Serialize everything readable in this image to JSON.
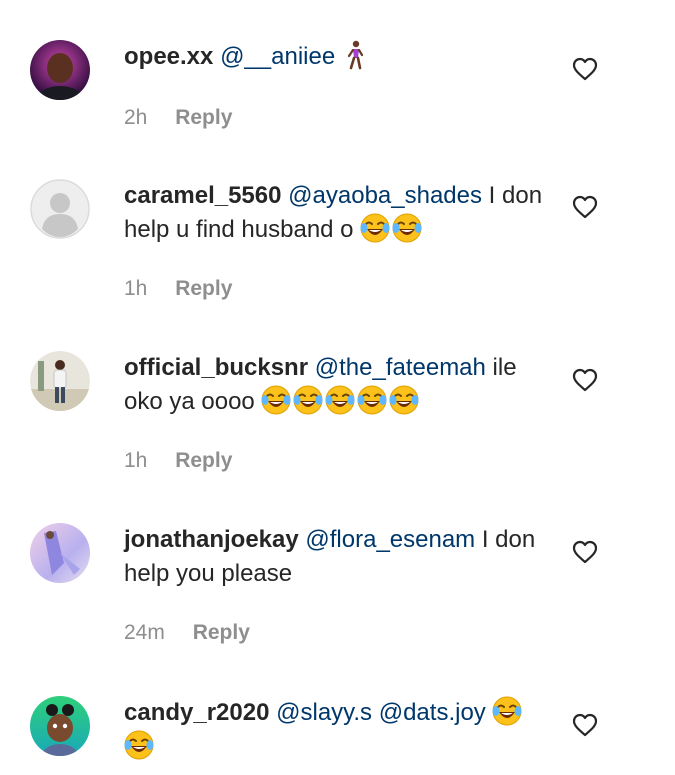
{
  "comments": [
    {
      "username": "opee.xx",
      "mention": "@__aniiee",
      "text": "",
      "emoji": "🚶🏾‍♀️",
      "emoji_count": 1,
      "time": "2h",
      "reply": "Reply",
      "avatar": "photo-avatar-dark"
    },
    {
      "username": "caramel_5560",
      "mention": "@ayaoba_shades",
      "text": "I don help u find husband o",
      "emoji": "😂",
      "emoji_count": 2,
      "time": "1h",
      "reply": "Reply",
      "avatar": "default-avatar"
    },
    {
      "username": "official_bucksnr",
      "mention": "@the_fateemah",
      "text": "ile oko ya oooo",
      "emoji": "😂",
      "emoji_count": 5,
      "time": "1h",
      "reply": "Reply",
      "avatar": "photo-avatar-standing"
    },
    {
      "username": "jonathanjoekay",
      "mention": "@flora_esenam",
      "text": "I don help you please",
      "emoji": "",
      "emoji_count": 0,
      "time": "24m",
      "reply": "Reply",
      "avatar": "photo-avatar-purple"
    },
    {
      "username": "candy_r2020",
      "mention": "@slayy.s @dats.joy",
      "text": "",
      "emoji": "😂",
      "emoji_count": 2,
      "time": "",
      "reply": "",
      "avatar": "cartoon-avatar"
    }
  ],
  "colors": {
    "mention": "#00376b",
    "meta": "#8e8e8e",
    "text": "#262626"
  },
  "icons": {
    "like": "heart-outline-icon",
    "laugh": "face-with-tears-of-joy-icon"
  }
}
